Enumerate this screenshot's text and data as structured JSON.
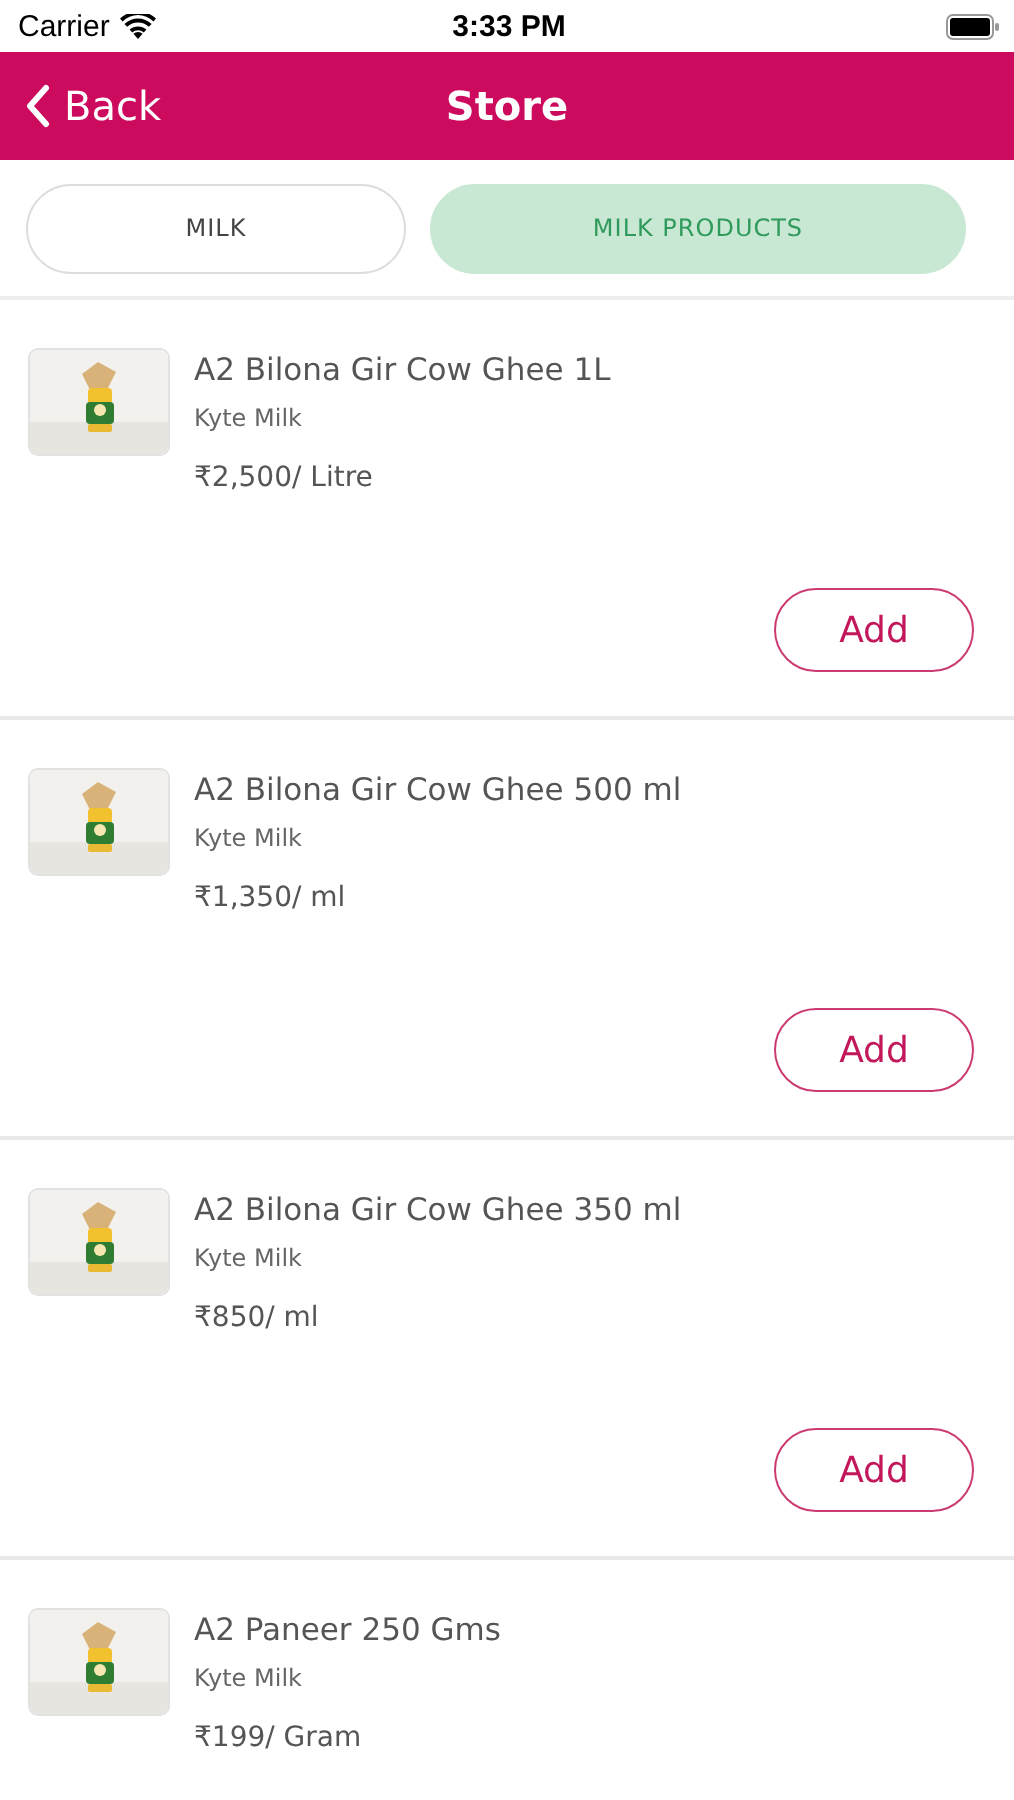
{
  "status_bar": {
    "carrier": "Carrier",
    "time": "3:33 PM"
  },
  "nav_bar": {
    "back": "Back",
    "title": "Store"
  },
  "tabs": [
    {
      "label": "MILK",
      "selected": false
    },
    {
      "label": "MILK PRODUCTS",
      "selected": true
    }
  ],
  "products": [
    {
      "name": "A2 Bilona Gir Cow Ghee 1L",
      "brand": "Kyte Milk",
      "price": "₹2,500/ Litre",
      "button": "Add"
    },
    {
      "name": "A2 Bilona Gir Cow Ghee 500 ml",
      "brand": "Kyte Milk",
      "price": "₹1,350/ ml",
      "button": "Add"
    },
    {
      "name": "A2 Bilona Gir Cow Ghee 350 ml",
      "brand": "Kyte Milk",
      "price": "₹850/ ml",
      "button": "Add"
    },
    {
      "name": "A2 Paneer 250 Gms",
      "brand": "Kyte Milk",
      "price": "₹199/ Gram"
    }
  ]
}
